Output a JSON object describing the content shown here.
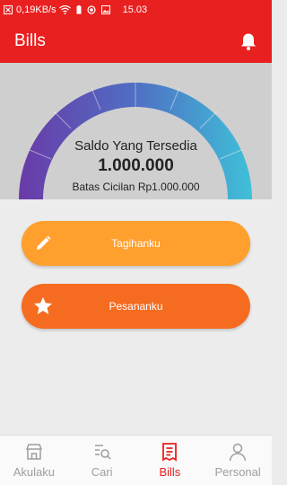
{
  "statusbar": {
    "network_speed": "0,19KB/s",
    "time": "15.03",
    "icons": [
      "close-box-icon",
      "wifi-icon",
      "battery-icon",
      "location-icon",
      "gallery-icon"
    ]
  },
  "appbar": {
    "title": "Bills",
    "icon": "bell-icon"
  },
  "balance": {
    "label": "Saldo Yang Tersedia",
    "amount": "1.000.000",
    "limit_text": "Batas Cicilan Rp1.000.000"
  },
  "actions": [
    {
      "label": "Tagihanku",
      "icon": "pencil-icon",
      "color": "#ff9f2e"
    },
    {
      "label": "Pesananku",
      "icon": "star-icon",
      "color": "#f56b1f"
    }
  ],
  "bottom_nav": {
    "items": [
      {
        "label": "Akulaku",
        "icon": "store-icon"
      },
      {
        "label": "Cari",
        "icon": "search-list-icon"
      },
      {
        "label": "Bills",
        "icon": "bills-icon"
      },
      {
        "label": "Personal",
        "icon": "person-icon"
      }
    ],
    "active": "Bills"
  },
  "colors": {
    "brand_red": "#e8201f",
    "gauge_start": "#6a3aa8",
    "gauge_end": "#3fc0d8"
  }
}
